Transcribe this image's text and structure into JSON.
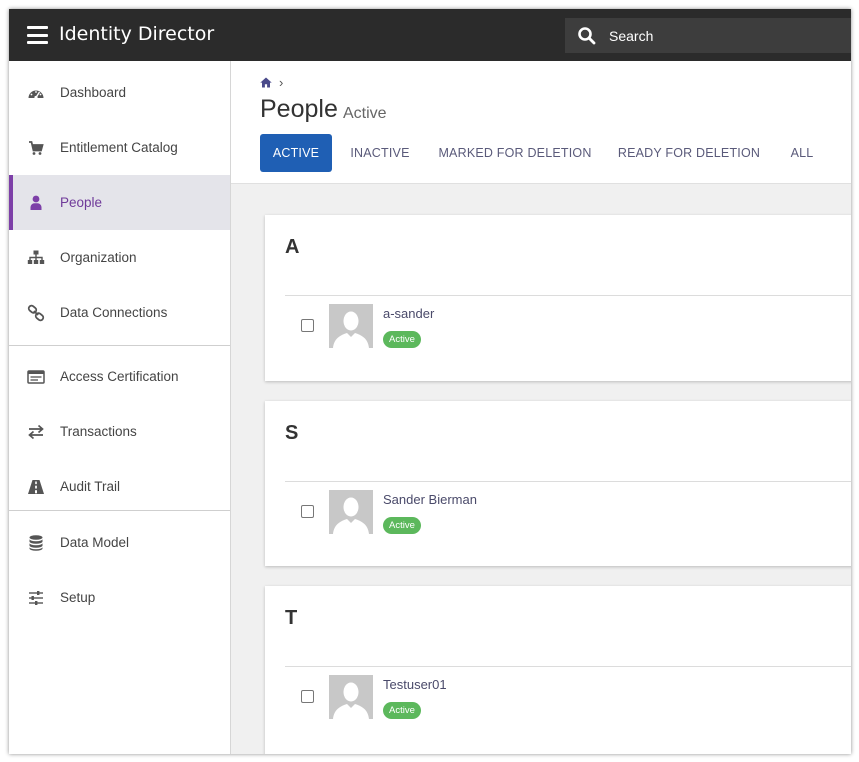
{
  "app": {
    "title": "Identity Director"
  },
  "search": {
    "placeholder": "Search"
  },
  "sidebar": {
    "items": [
      {
        "label": "Dashboard",
        "icon": "dashboard-icon"
      },
      {
        "label": "Entitlement Catalog",
        "icon": "cart-icon"
      },
      {
        "label": "People",
        "icon": "user-icon",
        "active": true
      },
      {
        "label": "Organization",
        "icon": "sitemap-icon"
      },
      {
        "label": "Data Connections",
        "icon": "link-icon"
      },
      {
        "label": "Access Certification",
        "icon": "certificate-icon"
      },
      {
        "label": "Transactions",
        "icon": "exchange-icon"
      },
      {
        "label": "Audit Trail",
        "icon": "road-icon"
      },
      {
        "label": "Data Model",
        "icon": "database-icon"
      },
      {
        "label": "Setup",
        "icon": "sliders-icon"
      }
    ]
  },
  "page": {
    "title": "People",
    "subtitle": "Active",
    "breadcrumb_sep": "›"
  },
  "tabs": [
    {
      "label": "ACTIVE",
      "active": true
    },
    {
      "label": "INACTIVE"
    },
    {
      "label": "MARKED FOR DELETION"
    },
    {
      "label": "READY FOR DELETION"
    },
    {
      "label": "ALL"
    }
  ],
  "groups": [
    {
      "letter": "A",
      "people": [
        {
          "name": "a-sander",
          "status": "Active"
        }
      ]
    },
    {
      "letter": "S",
      "people": [
        {
          "name": "Sander Bierman",
          "status": "Active"
        }
      ]
    },
    {
      "letter": "T",
      "people": [
        {
          "name": "Testuser01",
          "status": "Active"
        }
      ]
    }
  ],
  "colors": {
    "topbar": "#2b2b2b",
    "accent_purple": "#7d3fa8",
    "tab_active": "#1f5fb4",
    "badge_green": "#5cb85c"
  }
}
